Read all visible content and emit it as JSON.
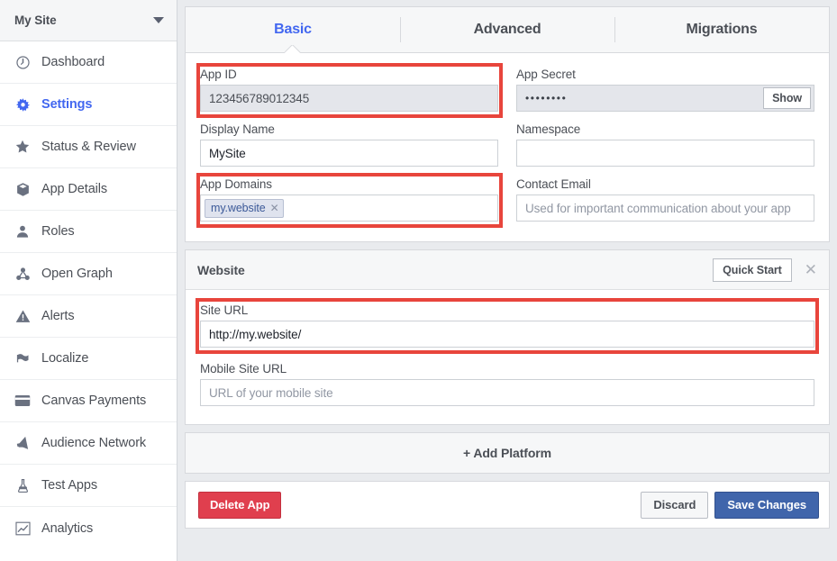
{
  "sidebar": {
    "header": {
      "title": "My Site",
      "caret_icon": "chevron-down-icon"
    },
    "items": [
      {
        "label": "Dashboard",
        "icon": "gauge-icon",
        "active": false
      },
      {
        "label": "Settings",
        "icon": "gear-icon",
        "active": true
      },
      {
        "label": "Status & Review",
        "icon": "star-icon",
        "active": false
      },
      {
        "label": "App Details",
        "icon": "box-icon",
        "active": false
      },
      {
        "label": "Roles",
        "icon": "person-icon",
        "active": false
      },
      {
        "label": "Open Graph",
        "icon": "graph-nodes-icon",
        "active": false
      },
      {
        "label": "Alerts",
        "icon": "warning-icon",
        "active": false
      },
      {
        "label": "Localize",
        "icon": "flag-icon",
        "active": false
      },
      {
        "label": "Canvas Payments",
        "icon": "credit-card-icon",
        "active": false
      },
      {
        "label": "Audience Network",
        "icon": "megaphone-icon",
        "active": false
      },
      {
        "label": "Test Apps",
        "icon": "flask-icon",
        "active": false
      },
      {
        "label": "Analytics",
        "icon": "line-chart-icon",
        "active": false
      }
    ]
  },
  "tabs": [
    {
      "label": "Basic",
      "active": true
    },
    {
      "label": "Advanced",
      "active": false
    },
    {
      "label": "Migrations",
      "active": false
    }
  ],
  "basic": {
    "app_id": {
      "label": "App ID",
      "value": "123456789012345",
      "readonly": true,
      "highlighted": true
    },
    "app_secret": {
      "label": "App Secret",
      "masked_value": "••••••••",
      "show_label": "Show"
    },
    "display_name": {
      "label": "Display Name",
      "value": "MySite",
      "placeholder": ""
    },
    "namespace": {
      "label": "Namespace",
      "value": "",
      "placeholder": ""
    },
    "app_domains": {
      "label": "App Domains",
      "tokens": [
        "my.website"
      ],
      "remove_icon": "close-icon",
      "highlighted": true
    },
    "contact_email": {
      "label": "Contact Email",
      "value": "",
      "placeholder": "Used for important communication about your app"
    }
  },
  "website": {
    "title": "Website",
    "quick_start_label": "Quick Start",
    "close_icon": "close-icon",
    "site_url": {
      "label": "Site URL",
      "value": "http://my.website/",
      "placeholder": "",
      "highlighted": true
    },
    "mobile_url": {
      "label": "Mobile Site URL",
      "value": "",
      "placeholder": "URL of your mobile site"
    }
  },
  "add_platform": {
    "label": "+ Add Platform"
  },
  "footer": {
    "delete_label": "Delete App",
    "discard_label": "Discard",
    "save_label": "Save Changes"
  },
  "colors": {
    "accent_blue": "#4267f0",
    "highlight_red": "#e8453c",
    "delete_red": "#e03f4e",
    "save_blue": "#4065ab",
    "page_bg": "#e9ebee"
  }
}
